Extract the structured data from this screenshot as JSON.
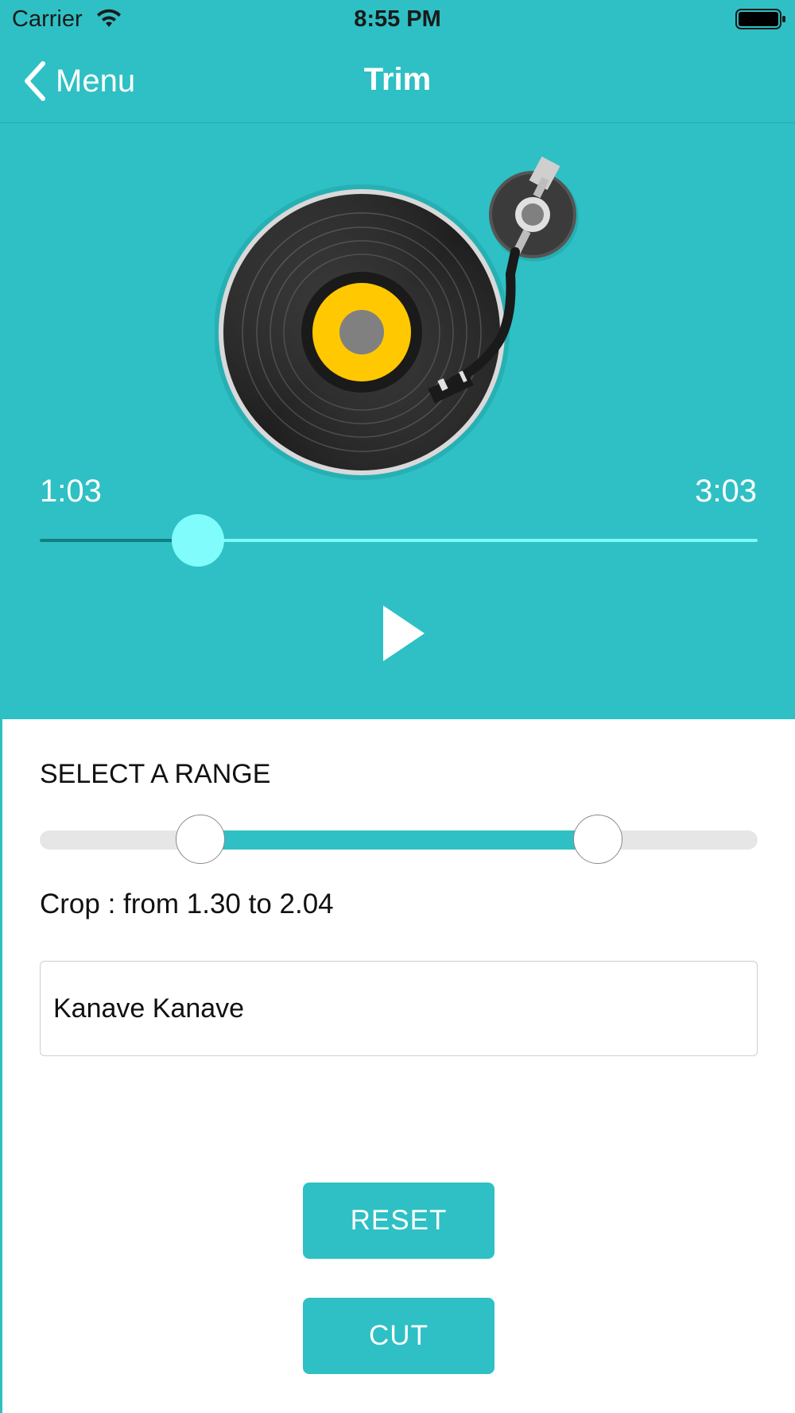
{
  "status_bar": {
    "carrier": "Carrier",
    "time": "8:55 PM",
    "icons": [
      "wifi-icon",
      "battery-icon"
    ]
  },
  "nav": {
    "back_label": "Menu",
    "back_icon": "chevron-left-icon",
    "title": "Trim"
  },
  "player": {
    "artwork": "turntable-icon",
    "current_time": "1:03",
    "total_time": "3:03",
    "progress_fraction": 0.22,
    "play_icon": "play-icon"
  },
  "range": {
    "title": "SELECT A RANGE",
    "start_fraction": 0.224,
    "end_fraction": 0.777,
    "crop_text": "Crop : from 1.30 to 2.04"
  },
  "name_field": {
    "value": "Kanave Kanave"
  },
  "buttons": {
    "reset": "RESET",
    "cut": "CUT"
  },
  "colors": {
    "accent": "#2ec0c4",
    "seek_thumb": "#7ffcfb",
    "seek_track": "#7df9f7",
    "seek_fill": "#127f82",
    "record_label": "#ffc800"
  }
}
